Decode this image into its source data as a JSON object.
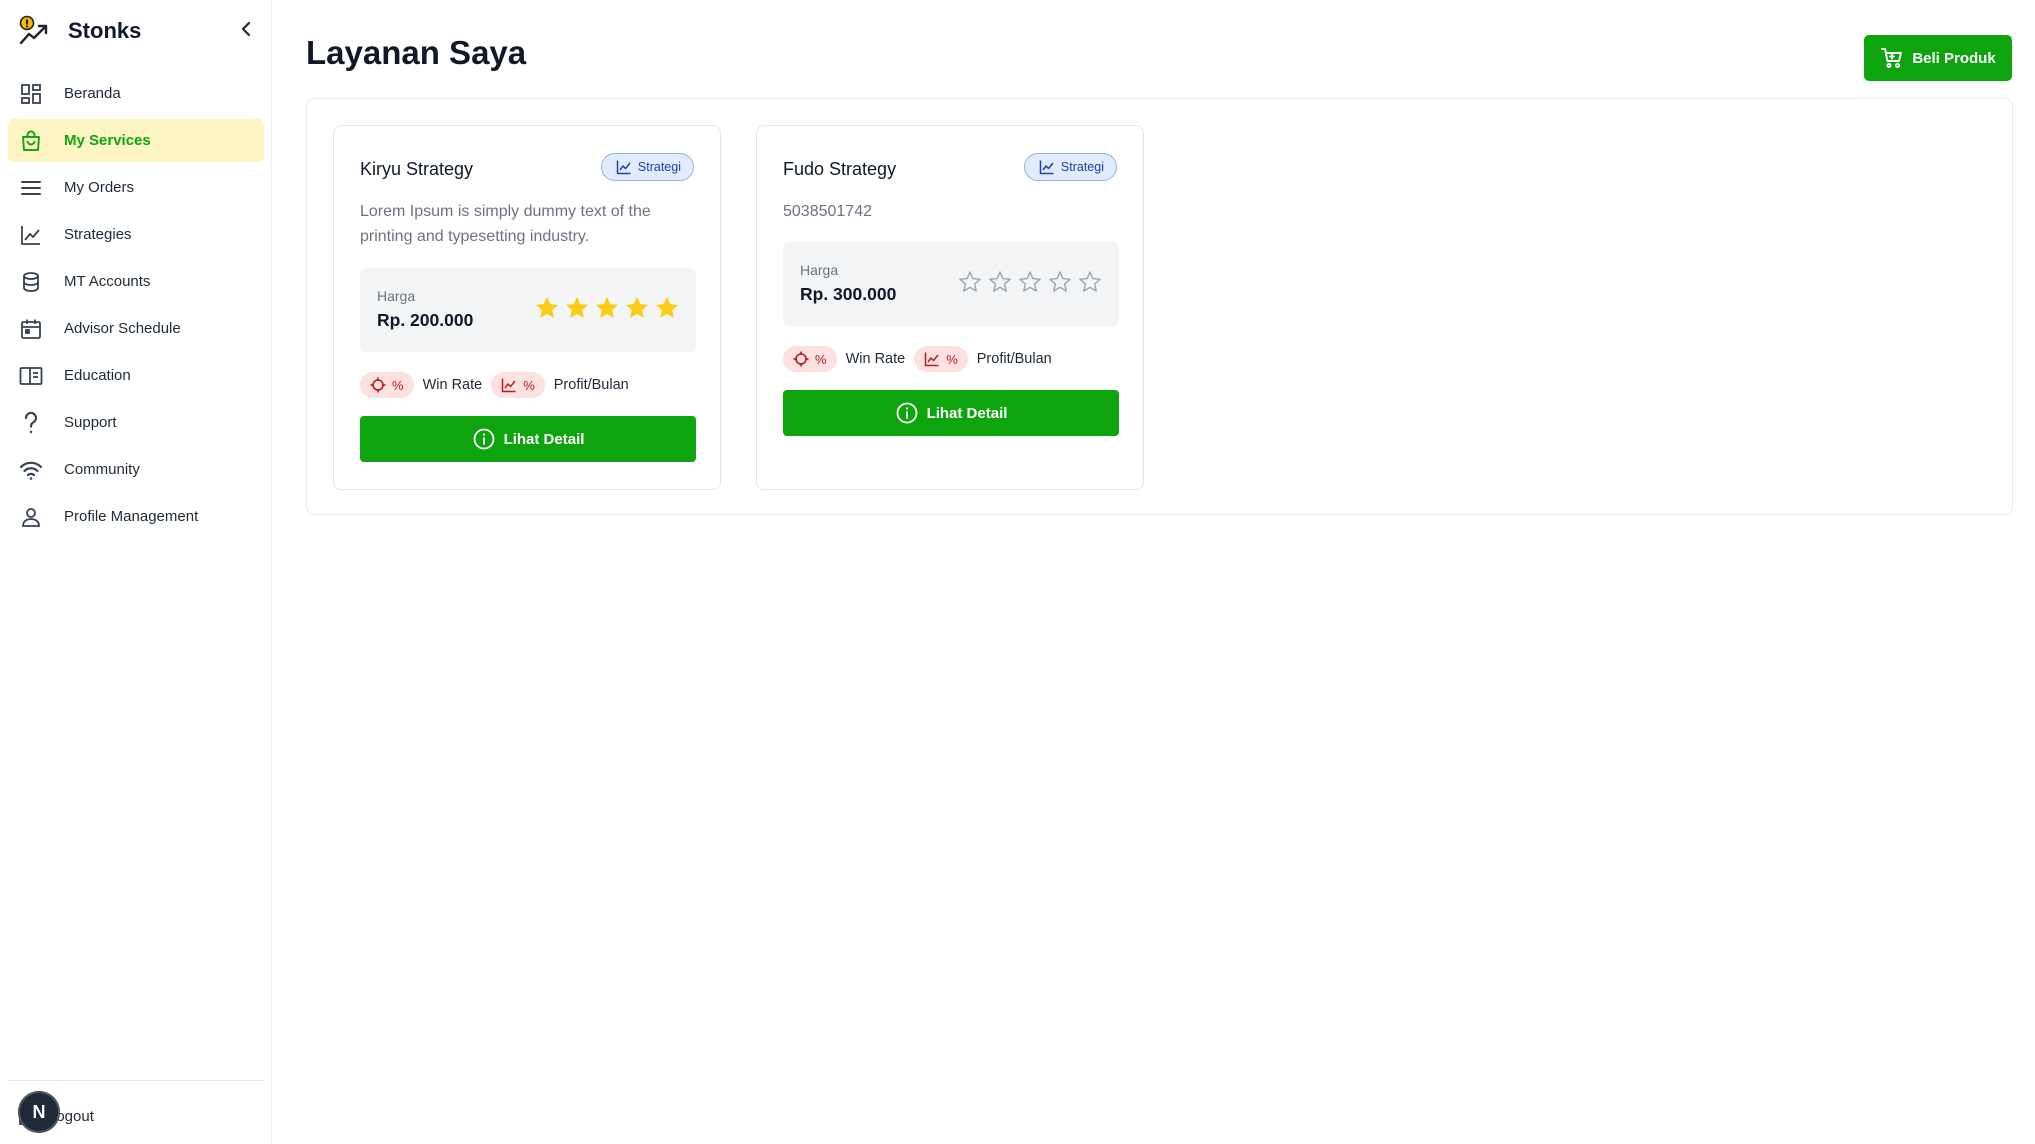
{
  "brand": {
    "name": "Stonks"
  },
  "sidebar": {
    "items": [
      {
        "label": "Beranda",
        "icon": "dashboard-grid-icon"
      },
      {
        "label": "My Services",
        "icon": "shopping-bag-icon",
        "active": true
      },
      {
        "label": "My Orders",
        "icon": "list-icon"
      },
      {
        "label": "Strategies",
        "icon": "line-chart-icon"
      },
      {
        "label": "MT Accounts",
        "icon": "database-icon"
      },
      {
        "label": "Advisor Schedule",
        "icon": "calendar-icon"
      },
      {
        "label": "Education",
        "icon": "book-icon"
      },
      {
        "label": "Support",
        "icon": "question-icon"
      },
      {
        "label": "Community",
        "icon": "wifi-icon"
      },
      {
        "label": "Profile Management",
        "icon": "user-icon"
      }
    ],
    "logout_label": "Logout",
    "avatar_letter": "N"
  },
  "main": {
    "title": "Layanan Saya",
    "buy_button": "Beli Produk"
  },
  "cards": [
    {
      "title": "Kiryu Strategy",
      "tag": "Strategi",
      "description": "Lorem Ipsum is simply dummy text of the printing and typesetting industry.",
      "price_label": "Harga",
      "price": "Rp. 200.000",
      "rating": 5,
      "rating_max": 5,
      "win_rate_value": "%",
      "win_rate_label": "Win Rate",
      "profit_value": "%",
      "profit_label": "Profit/Bulan",
      "detail_button": "Lihat Detail"
    },
    {
      "title": "Fudo Strategy",
      "tag": "Strategi",
      "description": "5038501742",
      "price_label": "Harga",
      "price": "Rp. 300.000",
      "rating": 0,
      "rating_max": 5,
      "win_rate_value": "%",
      "win_rate_label": "Win Rate",
      "profit_value": "%",
      "profit_label": "Profit/Bulan",
      "detail_button": "Lihat Detail"
    }
  ],
  "colors": {
    "accent_green": "#0ea40e",
    "active_bg": "#fdf4c4",
    "star_filled": "#facc15",
    "star_empty": "#9ca3af",
    "tag_bg": "#e0ecfb",
    "metric_bg": "#fde0e0"
  }
}
